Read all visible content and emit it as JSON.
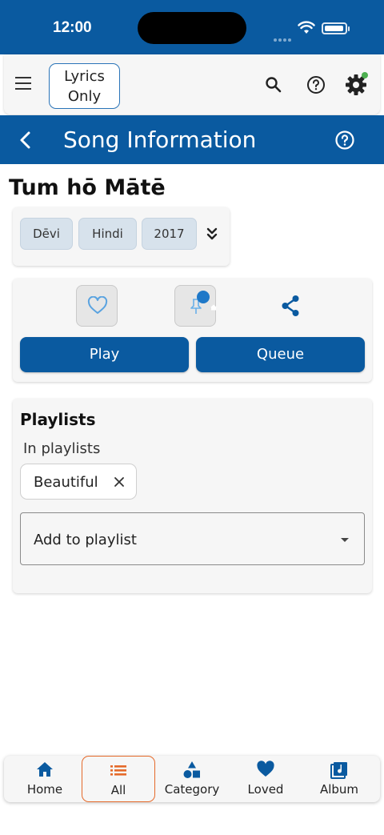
{
  "status": {
    "time": "12:00"
  },
  "toolbar": {
    "lyrics_toggle": "Lyrics\nOnly",
    "lyrics_line1": "Lyrics",
    "lyrics_line2": "Only"
  },
  "header": {
    "title": "Song Information"
  },
  "song": {
    "title": "Tum hō Mātē",
    "tags": [
      "Dēvi",
      "Hindi",
      "2017"
    ]
  },
  "actions": {
    "play": "Play",
    "queue": "Queue"
  },
  "playlists": {
    "heading": "Playlists",
    "in_label": "In playlists",
    "items": [
      "Beautiful"
    ],
    "add_label": "Add to playlist"
  },
  "nav": {
    "items": [
      {
        "label": "Home",
        "icon": "home-icon"
      },
      {
        "label": "All",
        "icon": "list-icon",
        "active": true
      },
      {
        "label": "Category",
        "icon": "category-icon"
      },
      {
        "label": "Loved",
        "icon": "heart-icon"
      },
      {
        "label": "Album",
        "icon": "album-icon"
      }
    ]
  },
  "colors": {
    "primary": "#0a5aa0",
    "active_nav_border": "#e56a2a",
    "status_dot": "#4caf50"
  }
}
